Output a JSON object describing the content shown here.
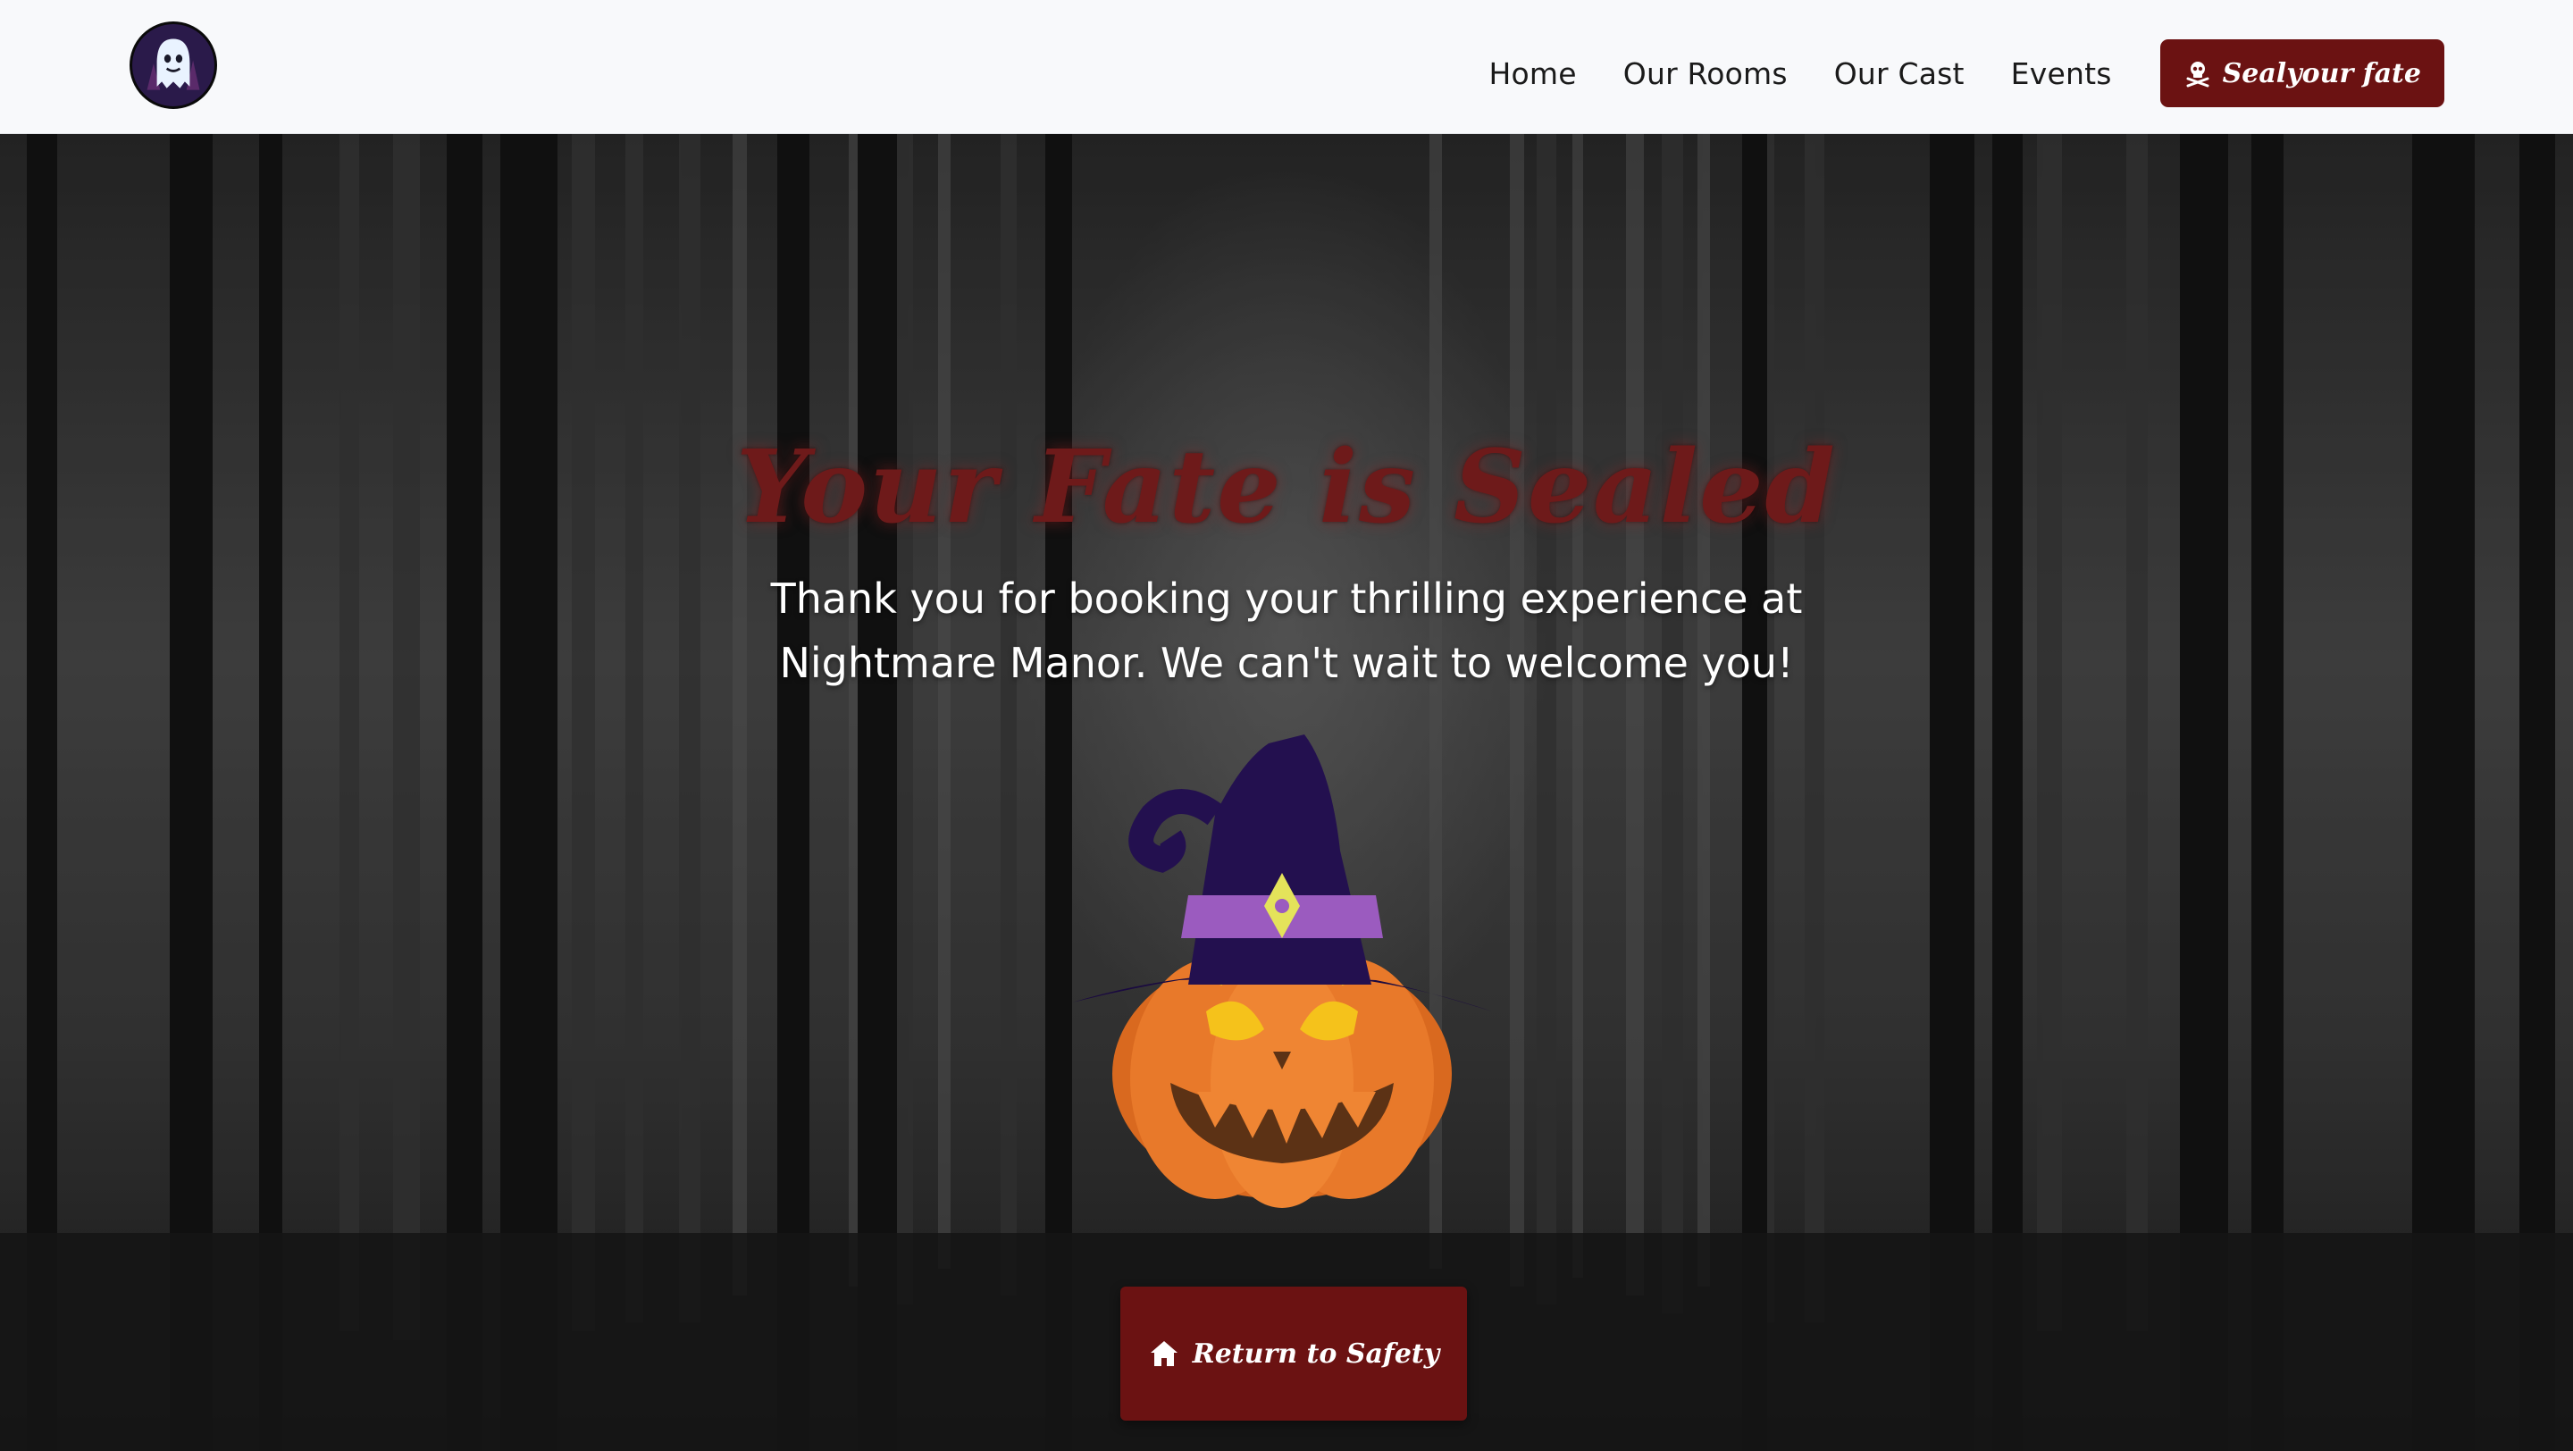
{
  "nav": {
    "logo_alt": "ghost logo",
    "links": [
      "Home",
      "Our Rooms",
      "Our Cast",
      "Events"
    ],
    "cta_label": "Sealyour fate",
    "cta_icon": "skull-crossbones-icon"
  },
  "hero": {
    "title": "Your Fate is Sealed",
    "subtitle": "Thank you for booking your thrilling experience at Nightmare Manor. We can't wait to welcome you!",
    "illustration": "pumpkin-witch-hat-icon",
    "button_label": "Return to Safety",
    "button_icon": "home-icon"
  },
  "colors": {
    "brand_red": "#6b1212",
    "title_red": "#6e1a1a",
    "nav_bg": "#f8f9fb",
    "pumpkin_orange": "#e8792a",
    "hat_purple": "#200a4a"
  }
}
